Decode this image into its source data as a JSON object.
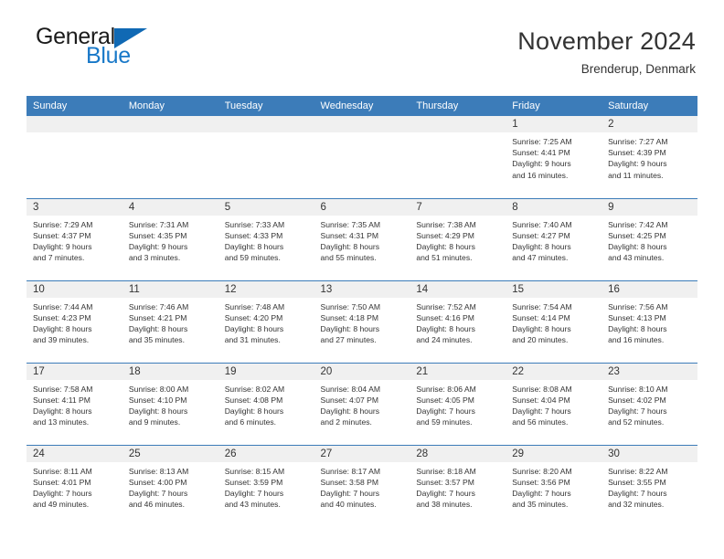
{
  "logo": {
    "word_top": "General",
    "word_bottom": "Blue",
    "accent_color": "#1069b4"
  },
  "header": {
    "title": "November 2024",
    "subtitle": "Brenderup, Denmark"
  },
  "theme": {
    "header_blue": "#3c7cb9",
    "band_gray": "#f0f0f0",
    "text": "#333333"
  },
  "calendar": {
    "weekday_headers": [
      "Sunday",
      "Monday",
      "Tuesday",
      "Wednesday",
      "Thursday",
      "Friday",
      "Saturday"
    ],
    "weeks": [
      [
        {
          "empty": true
        },
        {
          "empty": true
        },
        {
          "empty": true
        },
        {
          "empty": true
        },
        {
          "empty": true
        },
        {
          "day": "1",
          "sunrise": "Sunrise: 7:25 AM",
          "sunset": "Sunset: 4:41 PM",
          "daylight_1": "Daylight: 9 hours",
          "daylight_2": "and 16 minutes."
        },
        {
          "day": "2",
          "sunrise": "Sunrise: 7:27 AM",
          "sunset": "Sunset: 4:39 PM",
          "daylight_1": "Daylight: 9 hours",
          "daylight_2": "and 11 minutes."
        }
      ],
      [
        {
          "day": "3",
          "sunrise": "Sunrise: 7:29 AM",
          "sunset": "Sunset: 4:37 PM",
          "daylight_1": "Daylight: 9 hours",
          "daylight_2": "and 7 minutes."
        },
        {
          "day": "4",
          "sunrise": "Sunrise: 7:31 AM",
          "sunset": "Sunset: 4:35 PM",
          "daylight_1": "Daylight: 9 hours",
          "daylight_2": "and 3 minutes."
        },
        {
          "day": "5",
          "sunrise": "Sunrise: 7:33 AM",
          "sunset": "Sunset: 4:33 PM",
          "daylight_1": "Daylight: 8 hours",
          "daylight_2": "and 59 minutes."
        },
        {
          "day": "6",
          "sunrise": "Sunrise: 7:35 AM",
          "sunset": "Sunset: 4:31 PM",
          "daylight_1": "Daylight: 8 hours",
          "daylight_2": "and 55 minutes."
        },
        {
          "day": "7",
          "sunrise": "Sunrise: 7:38 AM",
          "sunset": "Sunset: 4:29 PM",
          "daylight_1": "Daylight: 8 hours",
          "daylight_2": "and 51 minutes."
        },
        {
          "day": "8",
          "sunrise": "Sunrise: 7:40 AM",
          "sunset": "Sunset: 4:27 PM",
          "daylight_1": "Daylight: 8 hours",
          "daylight_2": "and 47 minutes."
        },
        {
          "day": "9",
          "sunrise": "Sunrise: 7:42 AM",
          "sunset": "Sunset: 4:25 PM",
          "daylight_1": "Daylight: 8 hours",
          "daylight_2": "and 43 minutes."
        }
      ],
      [
        {
          "day": "10",
          "sunrise": "Sunrise: 7:44 AM",
          "sunset": "Sunset: 4:23 PM",
          "daylight_1": "Daylight: 8 hours",
          "daylight_2": "and 39 minutes."
        },
        {
          "day": "11",
          "sunrise": "Sunrise: 7:46 AM",
          "sunset": "Sunset: 4:21 PM",
          "daylight_1": "Daylight: 8 hours",
          "daylight_2": "and 35 minutes."
        },
        {
          "day": "12",
          "sunrise": "Sunrise: 7:48 AM",
          "sunset": "Sunset: 4:20 PM",
          "daylight_1": "Daylight: 8 hours",
          "daylight_2": "and 31 minutes."
        },
        {
          "day": "13",
          "sunrise": "Sunrise: 7:50 AM",
          "sunset": "Sunset: 4:18 PM",
          "daylight_1": "Daylight: 8 hours",
          "daylight_2": "and 27 minutes."
        },
        {
          "day": "14",
          "sunrise": "Sunrise: 7:52 AM",
          "sunset": "Sunset: 4:16 PM",
          "daylight_1": "Daylight: 8 hours",
          "daylight_2": "and 24 minutes."
        },
        {
          "day": "15",
          "sunrise": "Sunrise: 7:54 AM",
          "sunset": "Sunset: 4:14 PM",
          "daylight_1": "Daylight: 8 hours",
          "daylight_2": "and 20 minutes."
        },
        {
          "day": "16",
          "sunrise": "Sunrise: 7:56 AM",
          "sunset": "Sunset: 4:13 PM",
          "daylight_1": "Daylight: 8 hours",
          "daylight_2": "and 16 minutes."
        }
      ],
      [
        {
          "day": "17",
          "sunrise": "Sunrise: 7:58 AM",
          "sunset": "Sunset: 4:11 PM",
          "daylight_1": "Daylight: 8 hours",
          "daylight_2": "and 13 minutes."
        },
        {
          "day": "18",
          "sunrise": "Sunrise: 8:00 AM",
          "sunset": "Sunset: 4:10 PM",
          "daylight_1": "Daylight: 8 hours",
          "daylight_2": "and 9 minutes."
        },
        {
          "day": "19",
          "sunrise": "Sunrise: 8:02 AM",
          "sunset": "Sunset: 4:08 PM",
          "daylight_1": "Daylight: 8 hours",
          "daylight_2": "and 6 minutes."
        },
        {
          "day": "20",
          "sunrise": "Sunrise: 8:04 AM",
          "sunset": "Sunset: 4:07 PM",
          "daylight_1": "Daylight: 8 hours",
          "daylight_2": "and 2 minutes."
        },
        {
          "day": "21",
          "sunrise": "Sunrise: 8:06 AM",
          "sunset": "Sunset: 4:05 PM",
          "daylight_1": "Daylight: 7 hours",
          "daylight_2": "and 59 minutes."
        },
        {
          "day": "22",
          "sunrise": "Sunrise: 8:08 AM",
          "sunset": "Sunset: 4:04 PM",
          "daylight_1": "Daylight: 7 hours",
          "daylight_2": "and 56 minutes."
        },
        {
          "day": "23",
          "sunrise": "Sunrise: 8:10 AM",
          "sunset": "Sunset: 4:02 PM",
          "daylight_1": "Daylight: 7 hours",
          "daylight_2": "and 52 minutes."
        }
      ],
      [
        {
          "day": "24",
          "sunrise": "Sunrise: 8:11 AM",
          "sunset": "Sunset: 4:01 PM",
          "daylight_1": "Daylight: 7 hours",
          "daylight_2": "and 49 minutes."
        },
        {
          "day": "25",
          "sunrise": "Sunrise: 8:13 AM",
          "sunset": "Sunset: 4:00 PM",
          "daylight_1": "Daylight: 7 hours",
          "daylight_2": "and 46 minutes."
        },
        {
          "day": "26",
          "sunrise": "Sunrise: 8:15 AM",
          "sunset": "Sunset: 3:59 PM",
          "daylight_1": "Daylight: 7 hours",
          "daylight_2": "and 43 minutes."
        },
        {
          "day": "27",
          "sunrise": "Sunrise: 8:17 AM",
          "sunset": "Sunset: 3:58 PM",
          "daylight_1": "Daylight: 7 hours",
          "daylight_2": "and 40 minutes."
        },
        {
          "day": "28",
          "sunrise": "Sunrise: 8:18 AM",
          "sunset": "Sunset: 3:57 PM",
          "daylight_1": "Daylight: 7 hours",
          "daylight_2": "and 38 minutes."
        },
        {
          "day": "29",
          "sunrise": "Sunrise: 8:20 AM",
          "sunset": "Sunset: 3:56 PM",
          "daylight_1": "Daylight: 7 hours",
          "daylight_2": "and 35 minutes."
        },
        {
          "day": "30",
          "sunrise": "Sunrise: 8:22 AM",
          "sunset": "Sunset: 3:55 PM",
          "daylight_1": "Daylight: 7 hours",
          "daylight_2": "and 32 minutes."
        }
      ]
    ]
  }
}
